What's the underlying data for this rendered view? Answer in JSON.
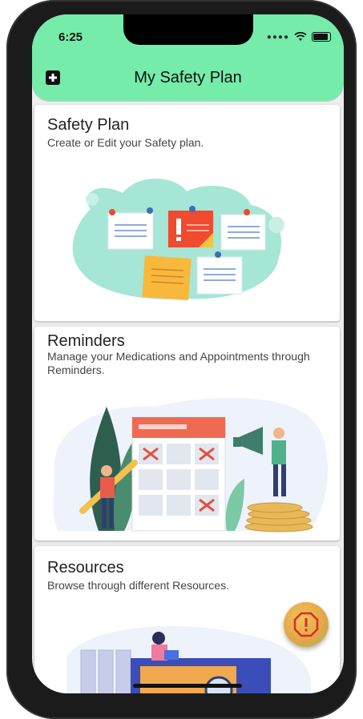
{
  "status_bar": {
    "time": "6:25",
    "signal_icon": "signal-dots-icon",
    "wifi_icon": "wifi-icon",
    "battery_icon": "battery-icon"
  },
  "header": {
    "title": "My Safety Plan",
    "left_icon": "medical-plus-icon"
  },
  "cards": [
    {
      "title": "Safety Plan",
      "subtitle": "Create or Edit your Safety plan.",
      "illustration": "pinned-notes-illustration"
    },
    {
      "title": "Reminders",
      "subtitle": "Manage your Medications and Appointments through Reminders.",
      "illustration": "calendar-reminders-illustration"
    },
    {
      "title": "Resources",
      "subtitle": "Browse through different Resources.",
      "illustration": "resources-library-illustration"
    }
  ],
  "fab": {
    "icon": "alert-octagon-icon"
  },
  "colors": {
    "header": "#75ecaa",
    "fab": "#e2a546",
    "accent_red": "#f04a2f",
    "teal": "#a6e6d6"
  }
}
